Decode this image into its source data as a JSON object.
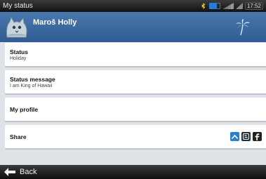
{
  "statusbar": {
    "title": "My status",
    "clock": "17:52",
    "icons": [
      "bluetooth-icon",
      "battery-icon",
      "signal-icon",
      "signal-bars-icon"
    ]
  },
  "profile": {
    "name": "Maroš Holly",
    "avatar_icon": "cat-avatar-icon",
    "status_icon": "palm-tree-icon",
    "header_color": "#3c6aa1"
  },
  "list": {
    "status": {
      "title": "Status",
      "value": "Holiday"
    },
    "status_message": {
      "title": "Status message",
      "value": "I am King of Hawaii"
    },
    "my_profile": {
      "title": "My profile"
    },
    "share": {
      "title": "Share",
      "icons": [
        "share-up-icon",
        "blogger-icon",
        "facebook-icon"
      ]
    }
  },
  "bottombar": {
    "back_label": "Back"
  }
}
